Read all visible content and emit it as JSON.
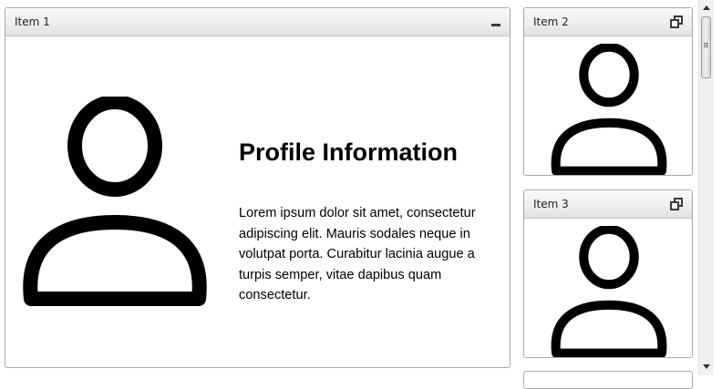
{
  "tiles": [
    {
      "title": "Item 1",
      "action_icon": "minimize-icon"
    },
    {
      "title": "Item 2",
      "action_icon": "restore-icon"
    },
    {
      "title": "Item 3",
      "action_icon": "restore-icon"
    }
  ],
  "profile": {
    "heading": "Profile Information",
    "body": "Lorem ipsum dolor sit amet, consectetur adipiscing elit. Mauris sodales neque in volutpat porta. Curabitur lacinia augue a turpis semper, vitae dapibus quam consectetur."
  },
  "icons": {
    "avatar": "user-icon",
    "scroll_up": "arrow-up-icon",
    "scroll_down": "arrow-down-icon"
  }
}
